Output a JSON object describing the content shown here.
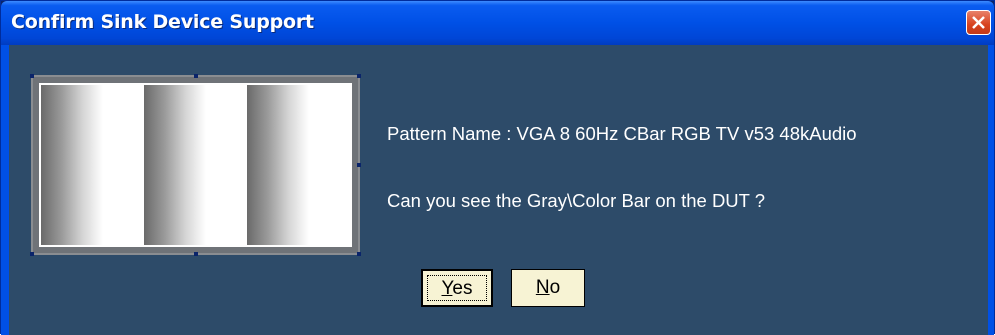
{
  "window": {
    "title": "Confirm Sink Device Support"
  },
  "content": {
    "pattern_name": "Pattern Name : VGA 8 60Hz CBar RGB TV v53 48kAudio",
    "question": "Can you see the Gray\\Color Bar on the DUT ?"
  },
  "buttons": {
    "yes_mnemonic": "Y",
    "yes_rest": "es",
    "no_mnemonic": "N",
    "no_rest": "o"
  },
  "colors": {
    "dialog_background": "#2d4b69",
    "titlebar": "#0050e6",
    "button_face": "#f7f3d4",
    "close_button": "#d8431f"
  },
  "icons": {
    "close": "close-x-icon"
  }
}
